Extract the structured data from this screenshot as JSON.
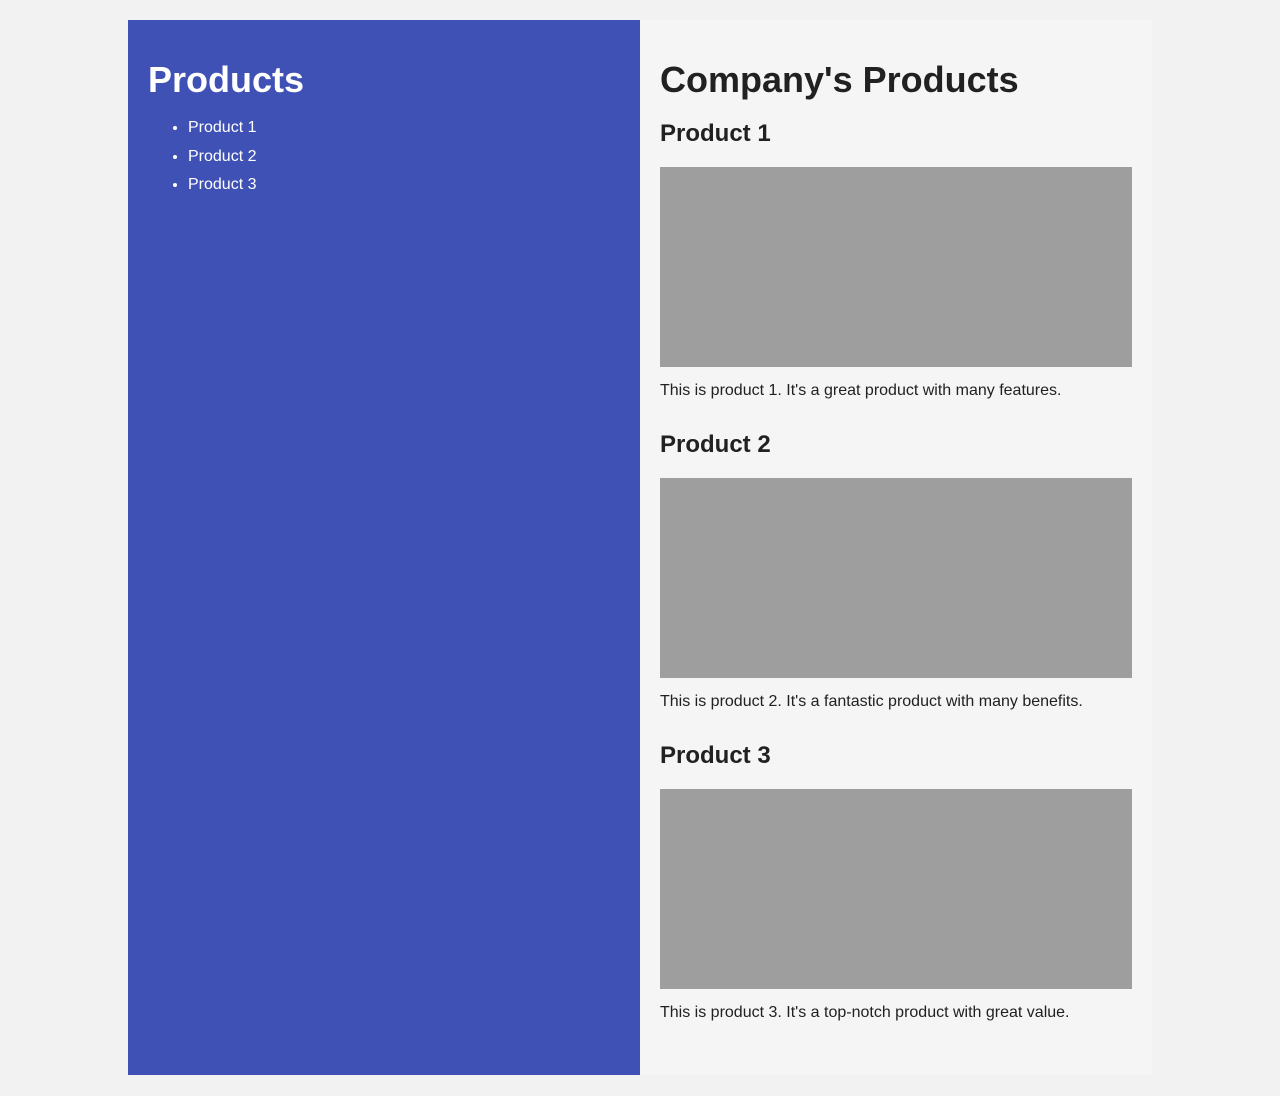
{
  "colors": {
    "page_background": "#f2f2f2",
    "sidebar_background": "#3f51b5",
    "main_background": "#f5f5f5",
    "image_placeholder": "#9e9e9e",
    "text_dark": "#212121",
    "text_light": "#ffffff"
  },
  "sidebar": {
    "title": "Products",
    "items": [
      {
        "label": "Product 1"
      },
      {
        "label": "Product 2"
      },
      {
        "label": "Product 3"
      }
    ]
  },
  "main": {
    "title": "Company's Products",
    "products": [
      {
        "name": "Product 1",
        "description": "This is product 1. It's a great product with many features."
      },
      {
        "name": "Product 2",
        "description": "This is product 2. It's a fantastic product with many benefits."
      },
      {
        "name": "Product 3",
        "description": "This is product 3. It's a top-notch product with great value."
      }
    ]
  }
}
